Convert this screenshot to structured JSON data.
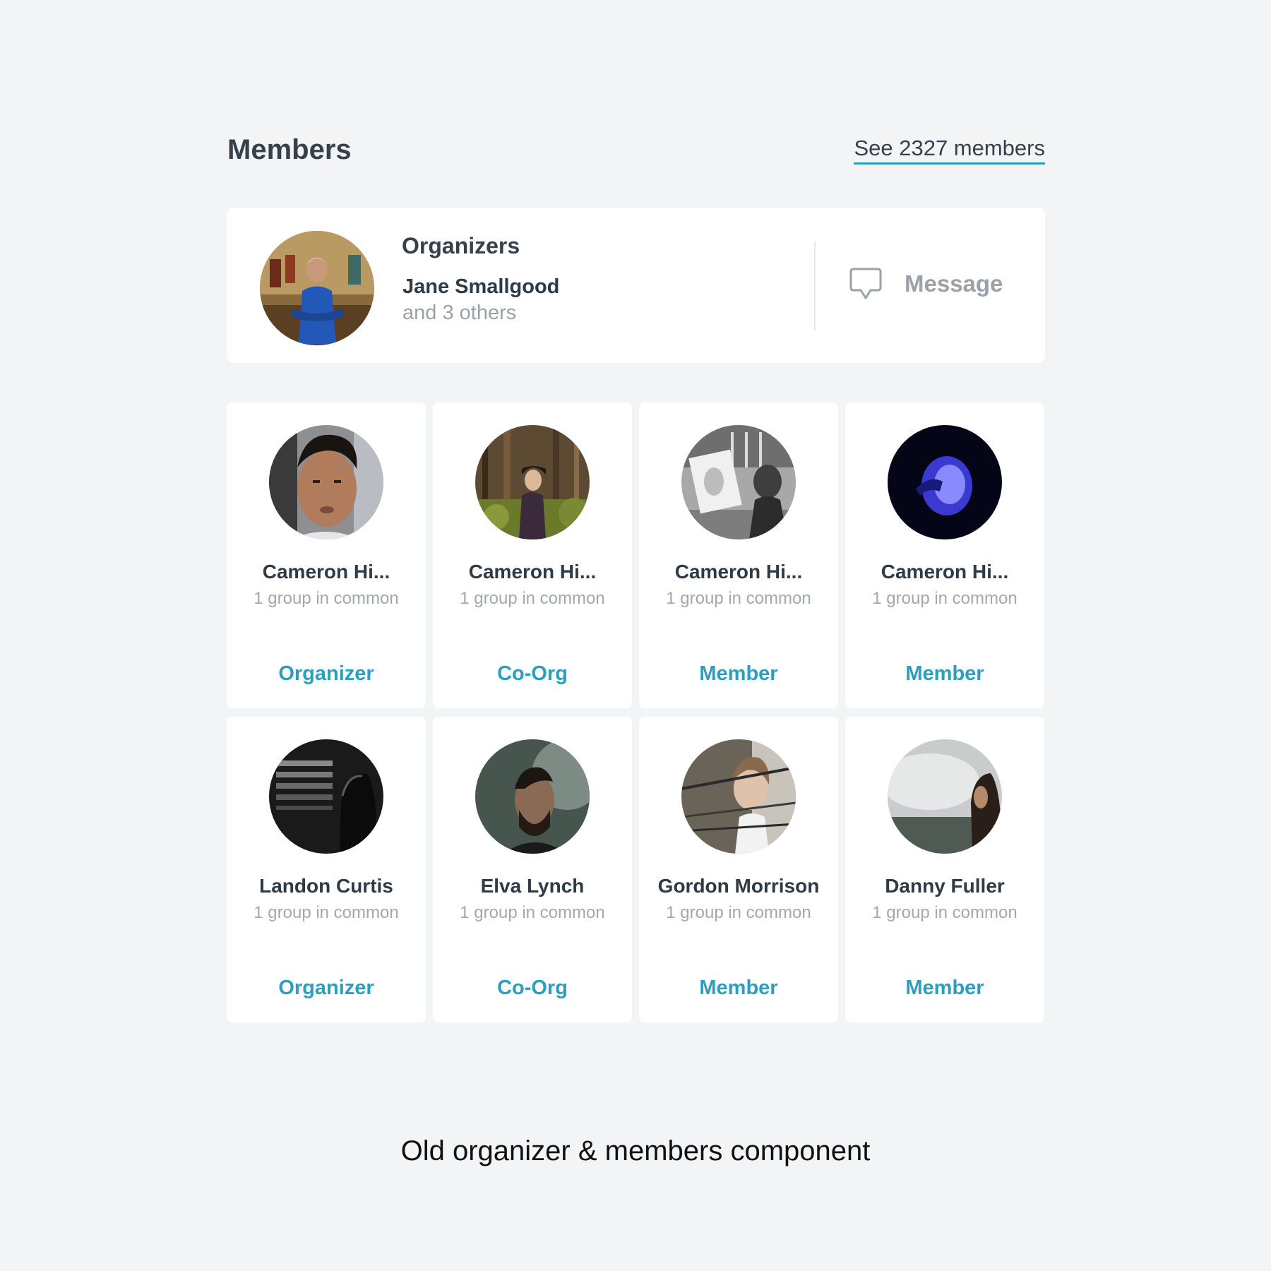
{
  "header": {
    "title": "Members",
    "see_all_label": "See 2327 members"
  },
  "organizers": {
    "title": "Organizers",
    "name": "Jane Smallgood",
    "others": "and 3 others",
    "message_label": "Message",
    "message_icon": "speech-bubble-icon"
  },
  "members": [
    {
      "name": "Cameron Hi...",
      "common": "1 group in common",
      "role": "Organizer"
    },
    {
      "name": "Cameron Hi...",
      "common": "1 group in common",
      "role": "Co-Org"
    },
    {
      "name": "Cameron Hi...",
      "common": "1 group in common",
      "role": "Member"
    },
    {
      "name": "Cameron Hi...",
      "common": "1 group in common",
      "role": "Member"
    },
    {
      "name": "Landon Curtis",
      "common": "1 group in common",
      "role": "Organizer"
    },
    {
      "name": "Elva Lynch",
      "common": "1 group in common",
      "role": "Co-Org"
    },
    {
      "name": "Gordon Morrison",
      "common": "1 group in common",
      "role": "Member"
    },
    {
      "name": "Danny Fuller",
      "common": "1 group in common",
      "role": "Member"
    }
  ],
  "colors": {
    "background": "#f3f4f6",
    "card": "#ffffff",
    "accent": "#2a9fc0",
    "text": "#2e3a46",
    "muted": "#9aa1a8"
  },
  "caption": "Old organizer & members component"
}
